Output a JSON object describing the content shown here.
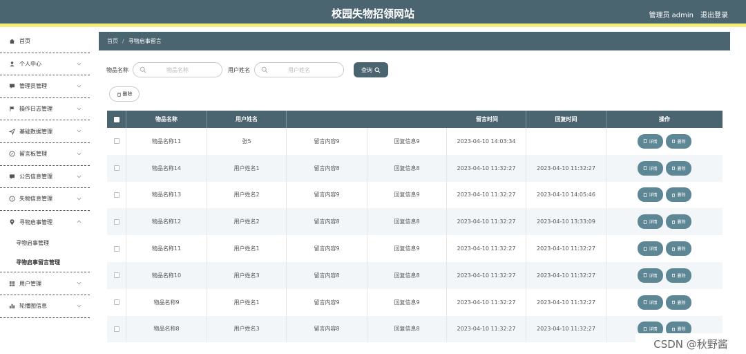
{
  "header": {
    "title": "校园失物招领网站",
    "user_label": "管理员 admin",
    "logout_label": "退出登录"
  },
  "sidebar": {
    "items": [
      {
        "label": "首页",
        "icon": "home-icon"
      },
      {
        "label": "个人中心",
        "icon": "person-icon"
      },
      {
        "label": "管理员管理",
        "icon": "chat-icon"
      },
      {
        "label": "操作日志管理",
        "icon": "flag-icon"
      },
      {
        "label": "基础数据管理",
        "icon": "send-icon"
      },
      {
        "label": "留言板管理",
        "icon": "compass-icon"
      },
      {
        "label": "公告信息管理",
        "icon": "chat-icon"
      },
      {
        "label": "失物信息管理",
        "icon": "question-icon"
      },
      {
        "label": "寻物启事管理",
        "icon": "location-icon"
      }
    ],
    "sub_items": [
      {
        "label": "寻物启事管理"
      },
      {
        "label": "寻物启事留言管理"
      }
    ],
    "items_after": [
      {
        "label": "用户管理",
        "icon": "grid-icon"
      },
      {
        "label": "轮播图信息",
        "icon": "bar-chart-icon"
      }
    ]
  },
  "breadcrumb": {
    "home": "首页",
    "separator": "/",
    "current": "寻物启事留言"
  },
  "search": {
    "name_label": "物品名称",
    "name_placeholder": "物品名称",
    "user_label": "用户姓名",
    "user_placeholder": "用户姓名",
    "query_label": "查询"
  },
  "actions": {
    "delete_label": "删除"
  },
  "table": {
    "headers": {
      "name": "物品名称",
      "user": "用户姓名",
      "msg_time": "留言时间",
      "reply_time": "回复时间",
      "ops": "操作"
    },
    "detail_label": "详情",
    "delete_label": "删除",
    "rows": [
      {
        "name": "物品名称11",
        "user": "张5",
        "msg": "留言内容9",
        "reply": "回复信息9",
        "mtime": "2023-04-10 14:03:34",
        "rtime": ""
      },
      {
        "name": "物品名称14",
        "user": "用户姓名1",
        "msg": "留言内容8",
        "reply": "回复信息8",
        "mtime": "2023-04-10 11:32:27",
        "rtime": "2023-04-10 11:32:27"
      },
      {
        "name": "物品名称13",
        "user": "用户姓名2",
        "msg": "留言内容9",
        "reply": "回复信息9",
        "mtime": "2023-04-10 11:32:27",
        "rtime": "2023-04-10 14:05:46"
      },
      {
        "name": "物品名称12",
        "user": "用户姓名2",
        "msg": "留言内容8",
        "reply": "回复信息8",
        "mtime": "2023-04-10 11:32:27",
        "rtime": "2023-04-10 13:33:09"
      },
      {
        "name": "物品名称11",
        "user": "用户姓名1",
        "msg": "留言内容9",
        "reply": "回复信息9",
        "mtime": "2023-04-10 11:32:27",
        "rtime": "2023-04-10 11:32:27"
      },
      {
        "name": "物品名称10",
        "user": "用户姓名3",
        "msg": "留言内容8",
        "reply": "回复信息8",
        "mtime": "2023-04-10 11:32:27",
        "rtime": "2023-04-10 11:32:27"
      },
      {
        "name": "物品名称9",
        "user": "用户姓名1",
        "msg": "留言内容9",
        "reply": "回复信息9",
        "mtime": "2023-04-10 11:32:27",
        "rtime": "2023-04-10 11:32:27"
      },
      {
        "name": "物品名称8",
        "user": "用户姓名3",
        "msg": "留言内容8",
        "reply": "回复信息8",
        "mtime": "2023-04-10 11:32:27",
        "rtime": "2023-04-10 11:32:27"
      }
    ]
  },
  "watermark": "CSDN @秋野酱",
  "colors": {
    "header_bg": "#4a6470",
    "accent_strip": "#f3f07a",
    "button": "#5e8796"
  }
}
